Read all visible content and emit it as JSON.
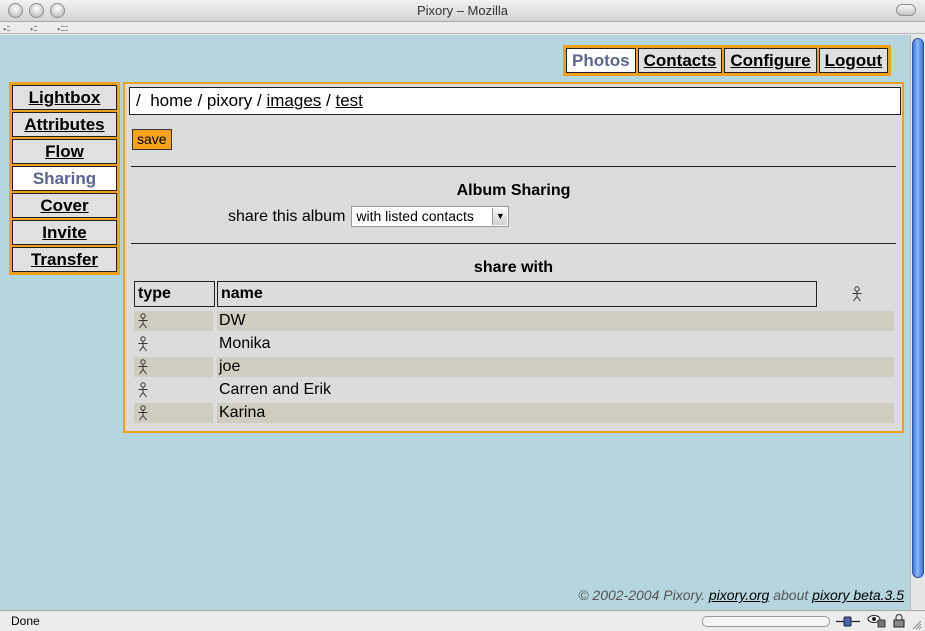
{
  "window": {
    "title": "Pixory – Mozilla"
  },
  "topnav": [
    {
      "label": "Photos",
      "active": true
    },
    {
      "label": "Contacts",
      "active": false
    },
    {
      "label": "Configure",
      "active": false
    },
    {
      "label": "Logout",
      "active": false
    }
  ],
  "sidenav": [
    {
      "label": "Lightbox",
      "active": false
    },
    {
      "label": "Attributes",
      "active": false
    },
    {
      "label": "Flow",
      "active": false
    },
    {
      "label": "Sharing",
      "active": true
    },
    {
      "label": "Cover",
      "active": false
    },
    {
      "label": "Invite",
      "active": false
    },
    {
      "label": "Transfer",
      "active": false
    }
  ],
  "breadcrumb": {
    "root": "/",
    "sep": "/",
    "home": "home",
    "pixory": "pixory",
    "images": "images",
    "test": "test"
  },
  "save_label": "save",
  "album_sharing": {
    "heading": "Album Sharing",
    "label": "share this album",
    "select_value": "with listed contacts"
  },
  "share_with": {
    "heading": "share with",
    "columns": {
      "type": "type",
      "name": "name"
    },
    "rows": [
      {
        "type_icon": "person-icon",
        "name": "DW"
      },
      {
        "type_icon": "person-icon",
        "name": "Monika"
      },
      {
        "type_icon": "person-icon",
        "name": "joe"
      },
      {
        "type_icon": "person-icon",
        "name": "Carren and Erik"
      },
      {
        "type_icon": "person-icon",
        "name": "Karina"
      }
    ]
  },
  "footer": {
    "copyright": "© 2002-2004 Pixory. ",
    "site_link": "pixory.org",
    "about": " about ",
    "version_link": "pixory beta.3.5"
  },
  "status": {
    "text": "Done"
  },
  "colors": {
    "accent": "#f0a020",
    "page_bg": "#b6d6df",
    "active_tab_text": "#5a6590",
    "row_alt": "#cfcdbf"
  }
}
